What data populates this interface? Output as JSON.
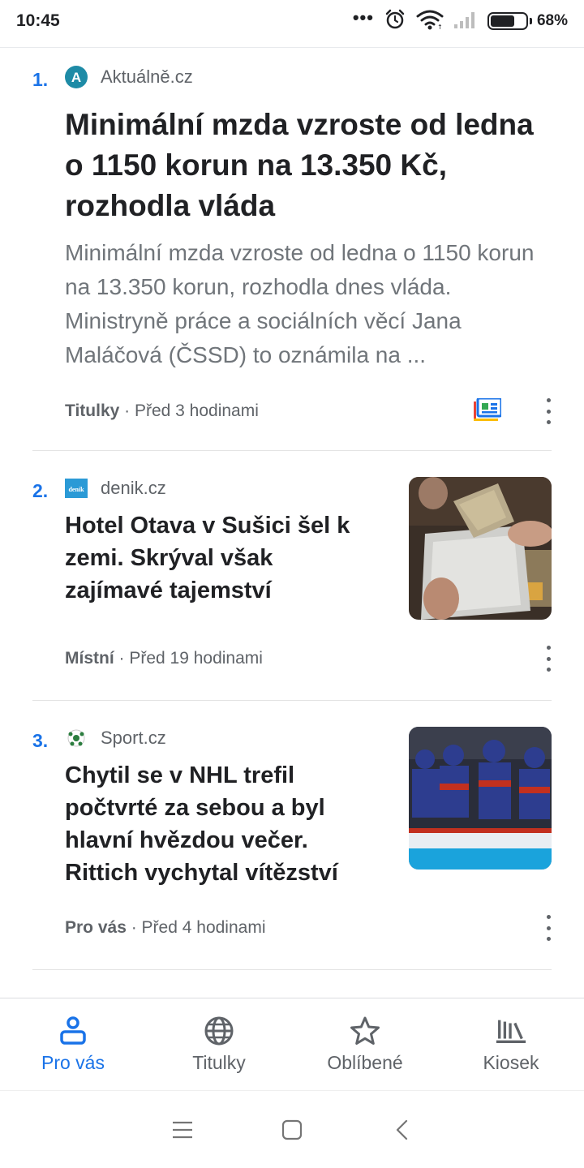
{
  "status_bar": {
    "time": "10:45",
    "dots": "•••",
    "battery_percent": "68%",
    "battery_level": 0.68,
    "icons": [
      "alarm-icon",
      "wifi-icon",
      "signal-icon",
      "battery-icon"
    ]
  },
  "articles": [
    {
      "rank": "1.",
      "source": "Aktuálně.cz",
      "source_logo_letter": "A",
      "headline": "Minimální mzda vzroste od ledna o 1150 korun na 13.350 Kč, rozhodla vláda",
      "snippet": "Minimální mzda vzroste od ledna o 1150 korun na 13.350 korun, rozhodla dnes vláda. Ministryně práce a sociálních věcí Jana Maláčová (ČSSD) to oznámila na ...",
      "category": "Titulky",
      "time": " · Před 3 hodinami"
    },
    {
      "rank": "2.",
      "source": "denik.cz",
      "source_logo_text": "deník",
      "headline": "Hotel Otava v Sušici šel k zemi. Skrýval však zajímavé tajemství",
      "category": "Místní",
      "time": " · Před 19 hodinami"
    },
    {
      "rank": "3.",
      "source": "Sport.cz",
      "headline": "Chytil se v NHL trefil počtvrté za sebou a byl hlavní hvězdou večer. Rittich vychytal vítězství",
      "category": "Pro vás",
      "time": " · Před 4 hodinami"
    }
  ],
  "bottom_nav": {
    "items": [
      {
        "label": "Pro vás",
        "icon": "for-you-icon",
        "active": true
      },
      {
        "label": "Titulky",
        "icon": "globe-icon",
        "active": false
      },
      {
        "label": "Oblíbené",
        "icon": "star-icon",
        "active": false
      },
      {
        "label": "Kiosek",
        "icon": "newsstand-icon",
        "active": false
      }
    ]
  },
  "system_nav": [
    "menu-icon",
    "home-icon",
    "back-icon"
  ],
  "colors": {
    "accent": "#1a73e8",
    "text_primary": "#202124",
    "text_secondary": "#5f6368"
  }
}
